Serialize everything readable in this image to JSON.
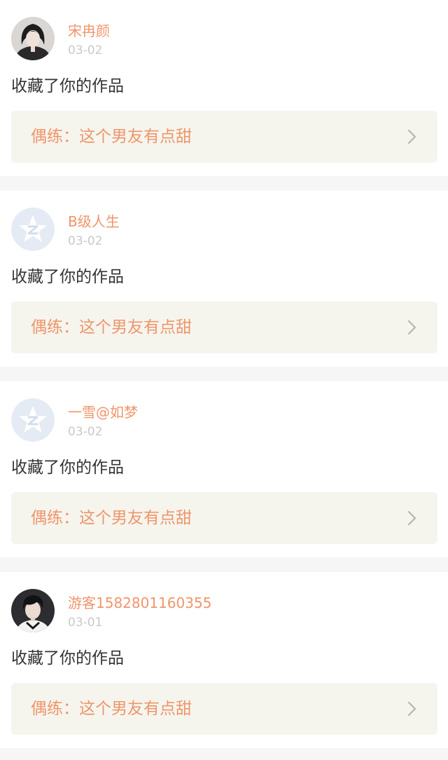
{
  "notifications": [
    {
      "user": "宋冉颜",
      "date": "03-02",
      "avatar": "photo-girl-avatar",
      "action": "收藏了你的作品",
      "work": "偶练：这个男友有点甜"
    },
    {
      "user": "B级人生",
      "date": "03-02",
      "avatar": "default-star-avatar",
      "action": "收藏了你的作品",
      "work": "偶练：这个男友有点甜"
    },
    {
      "user": "一雪@如梦",
      "date": "03-02",
      "avatar": "default-star-avatar",
      "action": "收藏了你的作品",
      "work": "偶练：这个男友有点甜"
    },
    {
      "user": "游客1582801160355",
      "date": "03-01",
      "avatar": "photo-boy-avatar",
      "action": "收藏了你的作品",
      "work": "偶练：这个男友有点甜"
    }
  ],
  "colors": {
    "accent": "#f0956a",
    "date": "#c9c9c9",
    "text": "#333333",
    "link_bg": "#f5f5ee",
    "page_bg": "#f6f6f6"
  },
  "icons": {
    "chevron": "chevron-right-icon"
  }
}
